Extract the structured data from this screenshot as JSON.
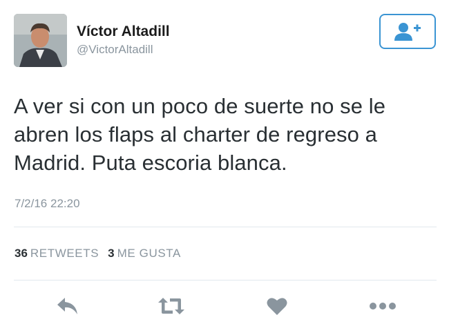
{
  "user": {
    "display_name": "Víctor Altadill",
    "handle": "@VictorAltadill"
  },
  "tweet": {
    "text": "A ver si con un poco de suerte no se le abren los flaps al charter de regreso a Madrid. Puta escoria blanca.",
    "timestamp": "7/2/16 22:20"
  },
  "stats": {
    "retweets_count": "36",
    "retweets_label": "RETWEETS",
    "likes_count": "3",
    "likes_label": "ME GUSTA"
  },
  "actions": {
    "reply_icon": "reply-icon",
    "retweet_icon": "retweet-icon",
    "like_icon": "heart-icon",
    "more_icon": "more-icon"
  },
  "colors": {
    "accent": "#3a94d3",
    "icon_gray": "#8a959e",
    "text_primary": "#292f33",
    "text_secondary": "#8a959e"
  }
}
